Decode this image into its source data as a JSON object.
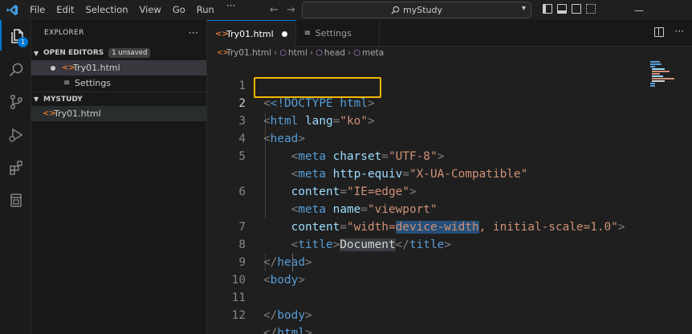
{
  "menu": [
    "File",
    "Edit",
    "Selection",
    "View",
    "Go",
    "Run"
  ],
  "menu_more": "···",
  "command_center": {
    "text": "myStudy"
  },
  "explorer": {
    "title": "EXPLORER",
    "more": "···",
    "open_editors": {
      "label": "OPEN EDITORS",
      "badge": "1 unsaved",
      "items": [
        {
          "name": "Try01.html",
          "unsaved": true
        },
        {
          "name": "Settings"
        }
      ]
    },
    "folder": {
      "label": "MYSTUDY",
      "items": [
        {
          "name": "Try01.html"
        }
      ]
    }
  },
  "activity_badge": "1",
  "tabs": [
    {
      "label": "Try01.html",
      "active": true,
      "unsaved": true
    },
    {
      "label": "Settings"
    }
  ],
  "breadcrumb": [
    "Try01.html",
    "html",
    "head",
    "meta"
  ],
  "code_lines": [
    {
      "n": "1"
    },
    {
      "n": "2"
    },
    {
      "n": "3"
    },
    {
      "n": "4"
    },
    {
      "n": "5"
    },
    {
      "n": ""
    },
    {
      "n": "6"
    },
    {
      "n": ""
    },
    {
      "n": "7"
    },
    {
      "n": "8"
    },
    {
      "n": "9"
    },
    {
      "n": "10"
    },
    {
      "n": "11"
    },
    {
      "n": "12"
    }
  ],
  "code": {
    "l1": {
      "doctype": "<!DOCTYPE",
      "html": "html",
      "close": ">"
    },
    "l2": {
      "tag": "html",
      "attr": "lang",
      "value": "\"ko\""
    },
    "l3": {
      "tag": "head"
    },
    "l4": {
      "tag": "meta",
      "attr": "charset",
      "value": "\"UTF-8\""
    },
    "l5": {
      "tag": "meta",
      "attr": "http-equiv",
      "value": "\"X-UA-Compatible\""
    },
    "l5b": {
      "attr": "content",
      "value": "\"IE=edge\""
    },
    "l6": {
      "tag": "meta",
      "attr": "name",
      "value": "\"viewport\""
    },
    "l6b": {
      "attr": "content",
      "v1": "\"width=",
      "v2": "device-width",
      "v3": ", initial-scale=1.0\""
    },
    "l7": {
      "tag": "title",
      "text": "Document",
      "ctag": "title"
    },
    "l8": {
      "tag": "head"
    },
    "l9": {
      "tag": "body"
    },
    "l11": {
      "tag": "body"
    },
    "l12": {
      "tag": "html"
    }
  },
  "colors": {
    "accent": "#0078d4",
    "highlight_box": "#f5b800",
    "tag": "#569cd6",
    "attribute": "#9cdcfe",
    "string": "#ce9178"
  }
}
